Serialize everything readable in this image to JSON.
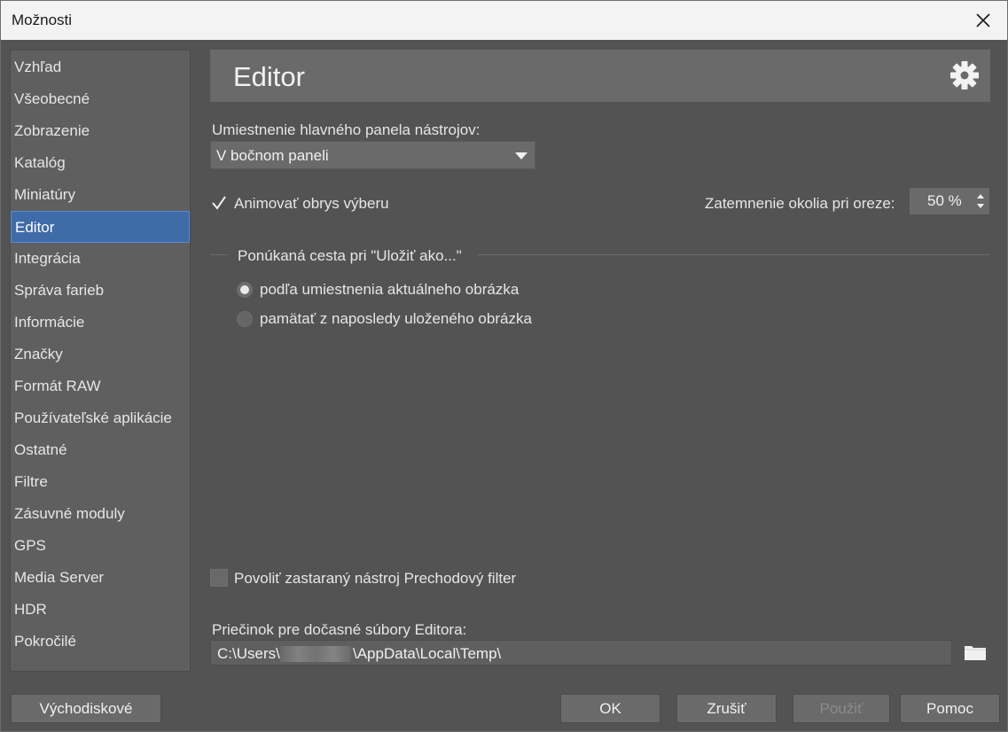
{
  "window": {
    "title": "Možnosti"
  },
  "sidebar": {
    "items": [
      {
        "label": "Vzhľad"
      },
      {
        "label": "Všeobecné"
      },
      {
        "label": "Zobrazenie"
      },
      {
        "label": "Katalóg"
      },
      {
        "label": "Miniatúry"
      },
      {
        "label": "Editor",
        "selected": true
      },
      {
        "label": "Integrácia"
      },
      {
        "label": "Správa farieb"
      },
      {
        "label": "Informácie"
      },
      {
        "label": "Značky"
      },
      {
        "label": "Formát RAW"
      },
      {
        "label": "Používateľské aplikácie"
      },
      {
        "label": "Ostatné"
      },
      {
        "label": "Filtre"
      },
      {
        "label": "Zásuvné moduly"
      },
      {
        "label": "GPS"
      },
      {
        "label": "Media Server"
      },
      {
        "label": "HDR"
      },
      {
        "label": "Pokročilé"
      }
    ]
  },
  "header": {
    "title": "Editor",
    "icon": "gear-icon"
  },
  "toolbar_position": {
    "label": "Umiestnenie hlavného panela nástrojov:",
    "selected": "V bočnom paneli"
  },
  "animate_selection": {
    "label": "Animovať obrys výberu",
    "checked": true
  },
  "crop_dimming": {
    "label": "Zatemnenie okolia pri oreze:",
    "value": "50 %"
  },
  "save_as_path": {
    "legend": "Ponúkaná cesta pri \"Uložiť ako...\"",
    "options": [
      {
        "label": "podľa umiestnenia aktuálneho obrázka",
        "selected": true
      },
      {
        "label": "pamätať z naposledy uloženého obrázka",
        "selected": false
      }
    ]
  },
  "legacy_filter": {
    "label": "Povoliť zastaraný nástroj Prechodový filter",
    "checked": false
  },
  "temp_folder": {
    "label": "Priečinok pre dočasné súbory Editora:",
    "path_start": "C:\\Users\\",
    "path_end": "\\AppData\\Local\\Temp\\"
  },
  "buttons": {
    "defaults": "Východiskové",
    "ok": "OK",
    "cancel": "Zrušiť",
    "apply": "Použiť",
    "help": "Pomoc"
  },
  "colors": {
    "selection": "#3f6ba8",
    "background": "#535353"
  }
}
